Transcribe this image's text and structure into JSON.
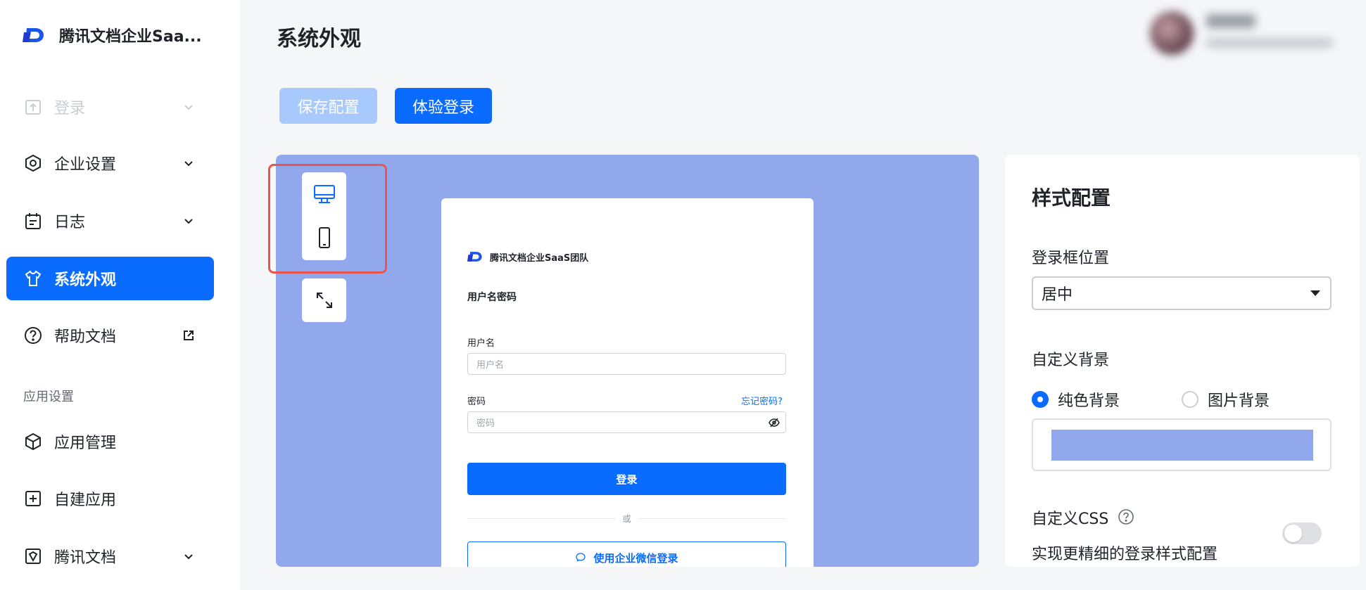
{
  "app": {
    "name": "腾讯文档企业Saa..."
  },
  "sidebar": {
    "items": [
      {
        "label": "登录",
        "icon": "login-icon"
      },
      {
        "label": "企业设置",
        "icon": "hexagon-settings-icon"
      },
      {
        "label": "日志",
        "icon": "calendar-log-icon"
      },
      {
        "label": "系统外观",
        "icon": "shirt-icon"
      },
      {
        "label": "帮助文档",
        "icon": "question-circle-icon"
      }
    ],
    "section_label": "应用设置",
    "app_items": [
      {
        "label": "应用管理",
        "icon": "cube-icon"
      },
      {
        "label": "自建应用",
        "icon": "plus-square-icon"
      },
      {
        "label": "腾讯文档",
        "icon": "tencent-docs-icon"
      }
    ]
  },
  "header": {
    "title": "系统外观"
  },
  "toolbar": {
    "save_label": "保存配置",
    "try_label": "体验登录"
  },
  "preview": {
    "background_color": "#91a9ec",
    "login_card": {
      "brand": "腾讯文档企业SaaS团队",
      "heading": "用户名密码",
      "username_label": "用户名",
      "username_placeholder": "用户名",
      "password_label": "密码",
      "password_placeholder": "密码",
      "forgot_label": "忘记密码?",
      "submit_label": "登录",
      "or_label": "或",
      "wechat_label": "使用企业微信登录"
    }
  },
  "config": {
    "title": "样式配置",
    "position_label": "登录框位置",
    "position_value": "居中",
    "background_label": "自定义背景",
    "bg_options": [
      "纯色背景",
      "图片背景"
    ],
    "bg_selected": "纯色背景",
    "bg_color": "#91a9ec",
    "css_label": "自定义CSS",
    "css_desc": "实现更精细的登录样式配置",
    "css_enabled": false
  },
  "colors": {
    "accent": "#0a6cff",
    "highlight": "#e85550"
  }
}
